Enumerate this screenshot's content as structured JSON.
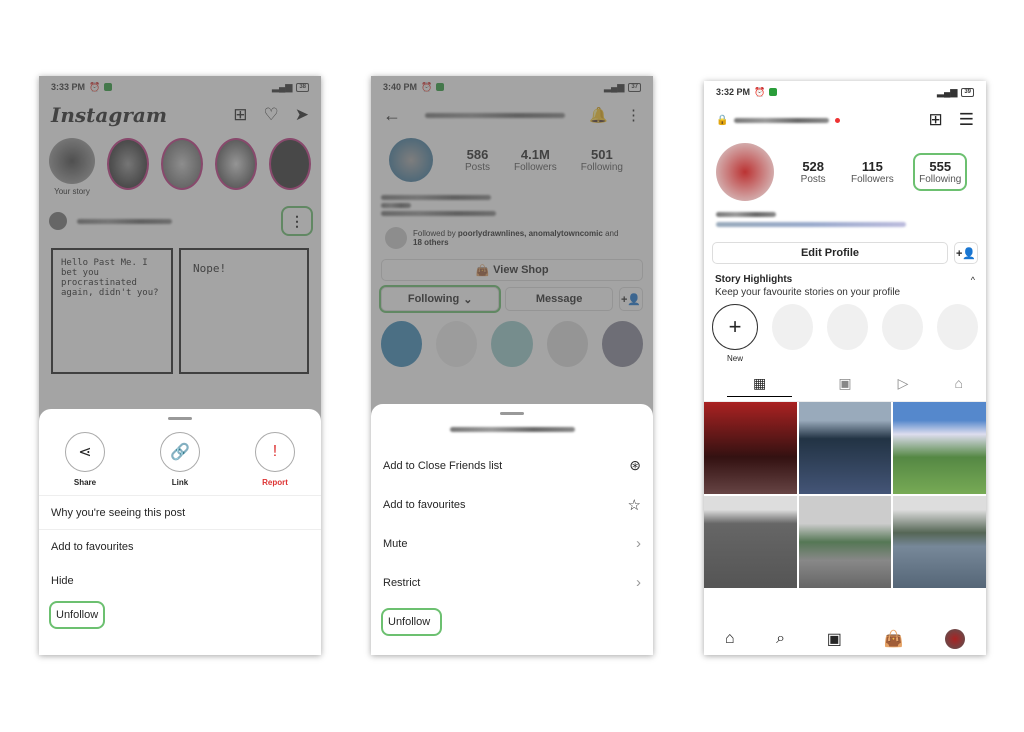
{
  "screen1": {
    "status": {
      "time": "3:33 PM",
      "battery": "38"
    },
    "app_title": "Instagram",
    "your_story_label": "Your story",
    "comic": {
      "panel1_text": "Hello Past Me. I bet you procrastinated again, didn't you?",
      "panel2_text": "Nope!",
      "panel2_bubble": "..."
    },
    "sheet": {
      "actions": [
        {
          "label": "Share",
          "icon": "share-icon"
        },
        {
          "label": "Link",
          "icon": "link-icon"
        },
        {
          "label": "Report",
          "icon": "report-icon"
        }
      ],
      "items": [
        "Why you're seeing this post",
        "Add to favourites",
        "Hide",
        "Unfollow"
      ]
    }
  },
  "screen2": {
    "status": {
      "time": "3:40 PM",
      "battery": "37"
    },
    "stats": [
      {
        "value": "586",
        "label": "Posts"
      },
      {
        "value": "4.1M",
        "label": "Followers"
      },
      {
        "value": "501",
        "label": "Following"
      }
    ],
    "followed_by": {
      "prefix": "Followed by ",
      "names": "poorlydrawnlines, anomalytowncomic",
      "suffix": " and",
      "others": "18 others"
    },
    "view_shop": "View Shop",
    "following_btn": "Following",
    "message_btn": "Message",
    "sheet": {
      "items": [
        {
          "label": "Add to Close Friends list",
          "icon": "close-friends-star-icon"
        },
        {
          "label": "Add to favourites",
          "icon": "star-icon"
        },
        {
          "label": "Mute",
          "icon": "chevron-right-icon"
        },
        {
          "label": "Restrict",
          "icon": "chevron-right-icon"
        },
        {
          "label": "Unfollow",
          "icon": ""
        }
      ]
    }
  },
  "screen3": {
    "status": {
      "time": "3:32 PM",
      "battery": "39"
    },
    "stats": [
      {
        "value": "528",
        "label": "Posts"
      },
      {
        "value": "115",
        "label": "Followers"
      },
      {
        "value": "555",
        "label": "Following"
      }
    ],
    "edit_profile": "Edit Profile",
    "highlights_title": "Story Highlights",
    "highlights_sub": "Keep your favourite stories on your profile",
    "new_label": "New",
    "accent": "#6cc070"
  }
}
